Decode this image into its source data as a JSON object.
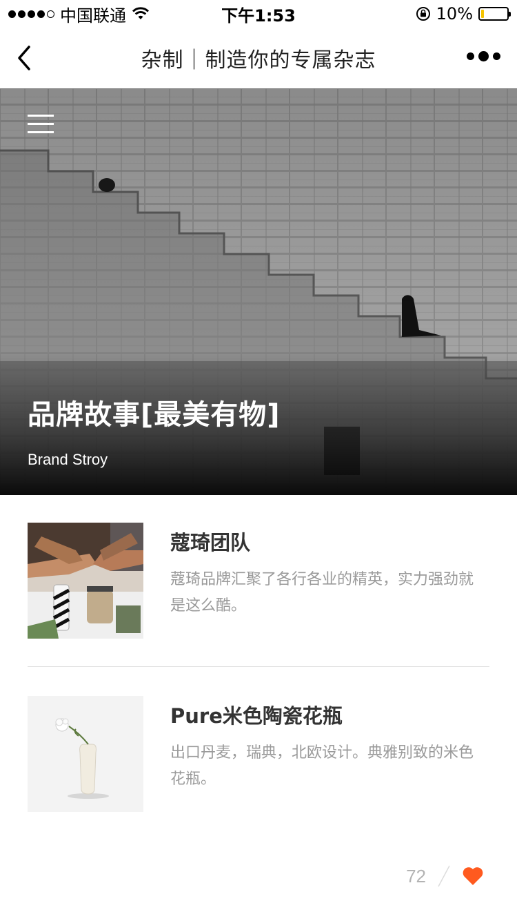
{
  "status_bar": {
    "carrier": "中国联通",
    "time": "下午1:53",
    "battery": "10%",
    "battery_level": 0.1,
    "battery_color": "#f5c400"
  },
  "nav": {
    "title": "杂制｜制造你的专属杂志",
    "back_icon": "chevron-left-icon",
    "more_icon": "more-dots-icon"
  },
  "hero": {
    "title": "品牌故事[最美有物]",
    "subtitle": "Brand Stroy",
    "menu_icon": "hamburger-menu-icon"
  },
  "articles": [
    {
      "title": "蔻琦团队",
      "description": "蔻琦品牌汇聚了各行各业的精英，实力强劲就是这么酷。"
    },
    {
      "title": "Pure米色陶瓷花瓶",
      "description": "出口丹麦，瑞典，北欧设计。典雅别致的米色花瓶。"
    }
  ],
  "footer": {
    "like_count": "72",
    "heart_color": "#ff5a1f"
  }
}
